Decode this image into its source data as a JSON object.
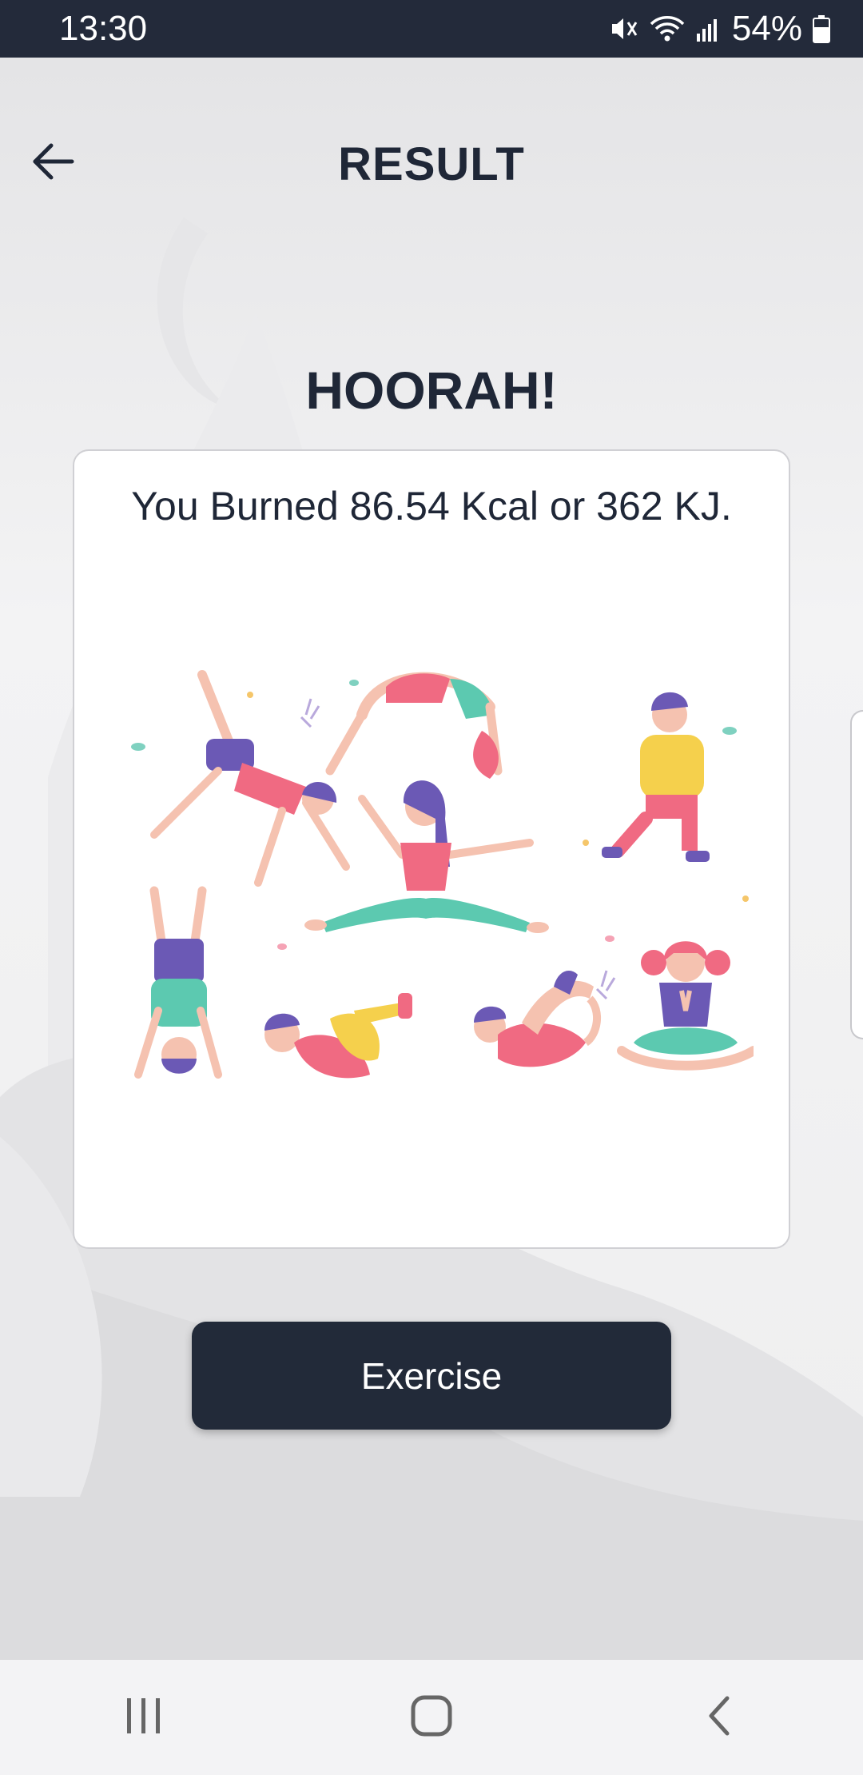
{
  "status_bar": {
    "time": "13:30",
    "battery": "54%",
    "icons": [
      "mute-icon",
      "wifi-icon",
      "signal-icon",
      "battery-icon"
    ]
  },
  "header": {
    "title": "RESULT",
    "back_icon": "arrow-left-icon"
  },
  "result": {
    "headline": "HOORAH!",
    "burned_text": "You Burned 86.54 Kcal or 362 KJ."
  },
  "actions": {
    "exercise_label": "Exercise"
  },
  "nav_bar": {
    "icons": [
      "recent-apps-icon",
      "home-icon",
      "back-icon"
    ]
  },
  "colors": {
    "dark": "#232a3a",
    "background": "#f0f0f1",
    "card": "#ffffff"
  }
}
